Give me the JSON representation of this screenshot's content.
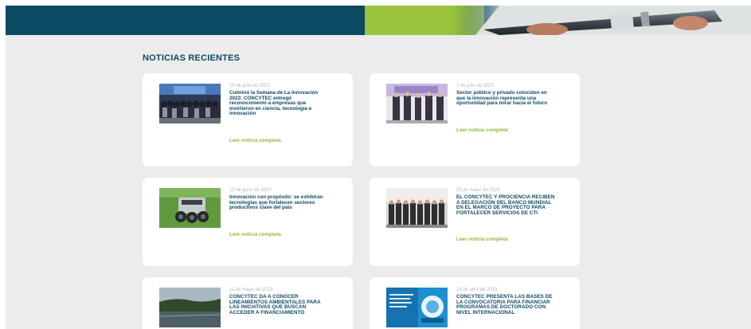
{
  "section_title": "NOTICIAS RECIENTES",
  "colors": {
    "brand_dark": "#0d4a63",
    "brand_green": "#9bc53d",
    "link_green": "#8dbb3a",
    "date_gray": "#b7b7b7",
    "page_bg": "#ececec"
  },
  "news": [
    {
      "date": "19 de julio de 2023",
      "title": "Culminó la Semana de La Innovación 2023: CONCYTEC entregó reconocimiento a empresas que invirtieron en ciencia, tecnología e innovación",
      "link": "Leer noticia completa"
    },
    {
      "date": "7 de julio de 2023",
      "title": "Sector público y privado coinciden en que la innovación representa una oportunidad para mirar hacia el futuro",
      "link": "Leer noticia completa"
    },
    {
      "date": "15 de junio de 2023",
      "title": "Innovación con propósito: se exhibirán tecnologías que fortalecen sectores productivos clave del país",
      "link": "Leer noticia completa"
    },
    {
      "date": "25 de mayo de 2023",
      "title": "EL CONCYTEC Y PROCIENCIA RECIBEN A DELEGACIÓN DEL BANCO MUNDIAL EN EL MARCO DE PROYECTO PARA FORTALECER SERVICIOS DE CTI",
      "link": "Leer noticia completa"
    },
    {
      "date": "11 de mayo de 2023",
      "title": "CONCYTEC DA A CONOCER LINEAMIENTOS AMBIENTALES PARA LAS INICIATIVAS QUE BUSCAN ACCEDER A FINANCIAMIENTO",
      "link": ""
    },
    {
      "date": "14 de abril de 2023",
      "title": "CONCYTEC PRESENTA LAS BASES DE LA CONVOCATORIA PARA FINANCIAR PROGRAMAS DE DOCTORADO CON NIVEL INTERNACIONAL",
      "link": ""
    }
  ]
}
